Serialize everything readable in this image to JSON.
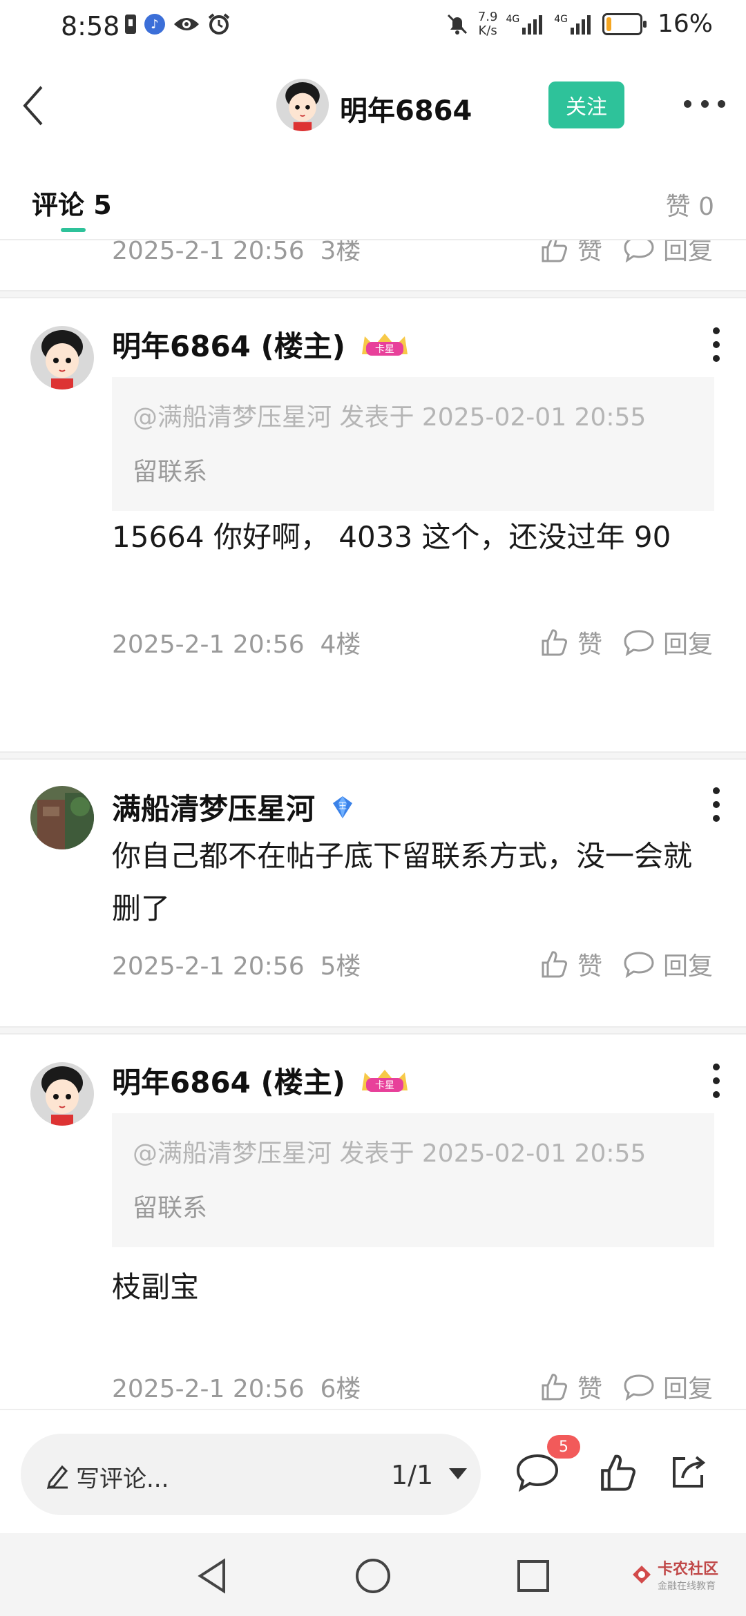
{
  "status_bar": {
    "time": "8:58",
    "net_speed_value": "7.9",
    "net_speed_unit": "K/s",
    "network_1": "4G",
    "network_2": "4G",
    "battery_percent": "16%",
    "battery_level": 0.16,
    "battery_color": "#f5a623"
  },
  "header": {
    "title": "明年6864",
    "follow_label": "关注"
  },
  "tabs": {
    "comments_label": "评论 5",
    "likes_label": "赞 0"
  },
  "actions": {
    "like_label": "赞",
    "reply_label": "回复"
  },
  "badges": {
    "card_star": "卡星",
    "vip": "王"
  },
  "comments": [
    {
      "timestamp": "2025-2-1 20:56",
      "floor": "3楼"
    },
    {
      "author": "明年6864 (楼主)",
      "quote_ref": "@满船清梦压星河 发表于 2025-02-01 20:55",
      "quote_body": "留联系",
      "body": "15664 你好啊， 4033 这个，还没过年 90",
      "timestamp": "2025-2-1 20:56",
      "floor": "4楼"
    },
    {
      "author": "满船清梦压星河",
      "body": "你自己都不在帖子底下留联系方式，没一会就删了",
      "timestamp": "2025-2-1 20:56",
      "floor": "5楼"
    },
    {
      "author": "明年6864 (楼主)",
      "quote_ref": "@满船清梦压星河 发表于 2025-02-01 20:55",
      "quote_body": "留联系",
      "body": "枝副宝",
      "timestamp": "2025-2-1 20:56",
      "floor": "6楼"
    }
  ],
  "bottom_bar": {
    "compose_placeholder": "写评论...",
    "pager": "1/1",
    "comment_count": "5"
  },
  "watermark": {
    "title": "卡农社区",
    "subtitle": "金融在线教育"
  },
  "colors": {
    "accent": "#2ec29a",
    "badge_red": "#f25a5a"
  }
}
